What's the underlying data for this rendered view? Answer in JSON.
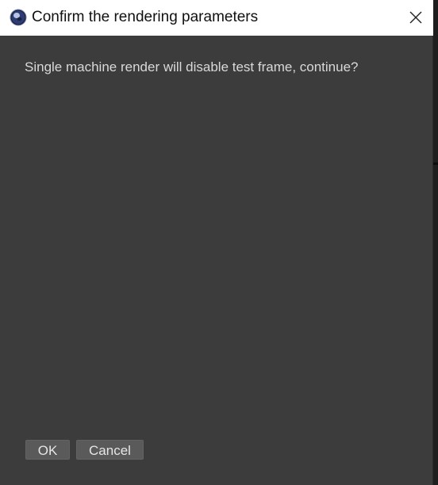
{
  "window": {
    "title": "Confirm the rendering parameters",
    "message": "Single machine render will disable test frame, continue?"
  },
  "buttons": {
    "ok_label": "OK",
    "cancel_label": "Cancel"
  },
  "icons": {
    "app": "cinema4d-app-icon",
    "close": "close-icon"
  },
  "colors": {
    "titlebar_bg": "#ffffff",
    "dialog_bg": "#3c3c3c",
    "button_bg": "#5a5a5a",
    "text": "#d9d9d9"
  }
}
